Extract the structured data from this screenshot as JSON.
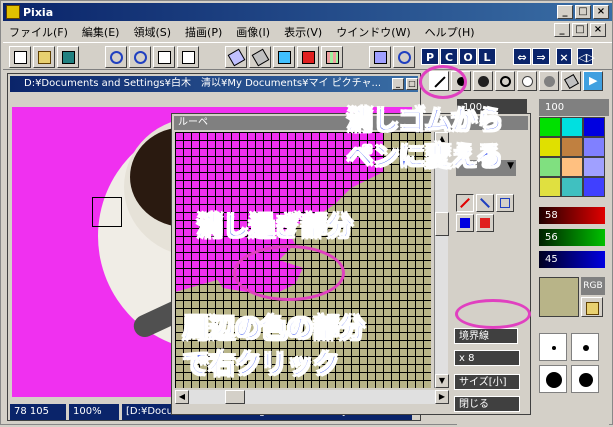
{
  "window": {
    "title": "Pixia"
  },
  "menu": [
    "ファイル(F)",
    "編集(E)",
    "領域(S)",
    "描画(P)",
    "画像(I)",
    "表示(V)",
    "ウインドウ(W)",
    "ヘルプ(H)"
  ],
  "toolbar": {
    "p_label": "P",
    "c_label": "C",
    "o_label": "O",
    "l_label": "L"
  },
  "document": {
    "title": "D:¥Documents and Settings¥白木　清以¥My Documents¥マイ ピクチャ..."
  },
  "status": {
    "coords": "78  105",
    "zoom": "100%",
    "path": "[D:¥Documents and Settings¥白木　清以¥My"
  },
  "loupe": {
    "title": "ルーペ",
    "border_button": "境界線",
    "zoom_value": "x 8",
    "size_button": "サイズ[小]",
    "close_button": "閉じる"
  },
  "palette": {
    "top_value": "100",
    "top_value2": "100",
    "r_value": "58",
    "g_value": "56",
    "b_value": "45",
    "rgb_label": "RGB"
  },
  "annotations": {
    "top_right_line1": "消しゴムから",
    "top_right_line2": "ペンに変える",
    "middle": "消し過ぎ部分",
    "bottom_line1": "周辺の色の部分",
    "bottom_line2": "で右クリック"
  },
  "colors": {
    "canvas": "#f030f0",
    "title_bar": "#0a246a",
    "annotation_text": "#1030f0",
    "annotation_ellipse": "#e040c0",
    "loupe_fill": "#b8b488"
  }
}
